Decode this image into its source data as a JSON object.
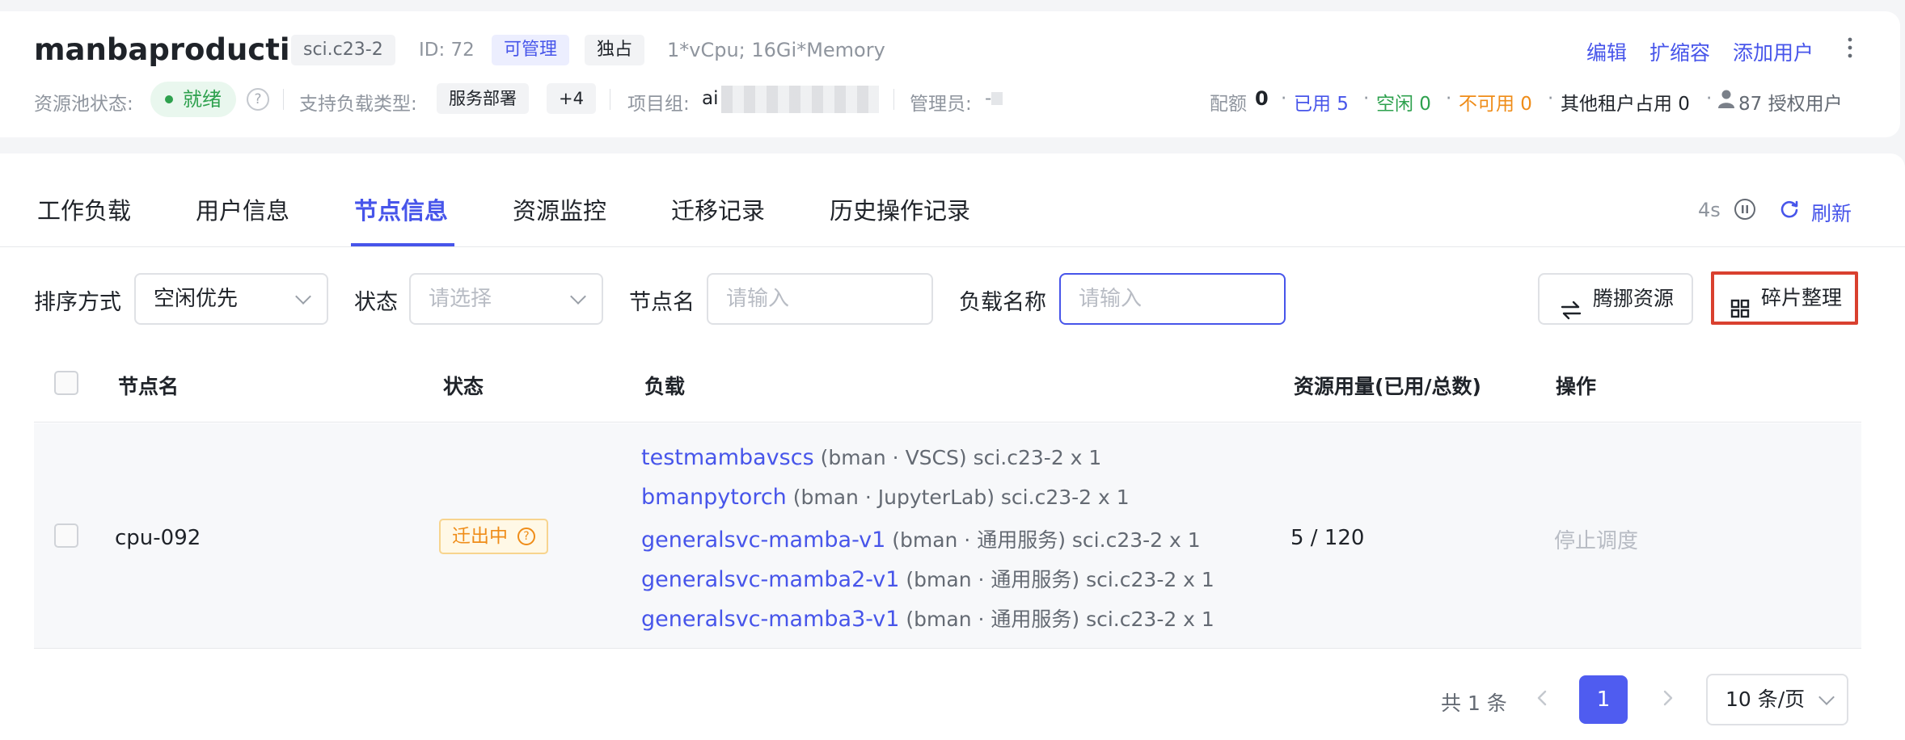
{
  "header": {
    "pool_name": "manbaproduction",
    "spec_tag": "sci.c23-2",
    "id_text": "ID: 72",
    "manage_tag": "可管理",
    "exclusive_tag": "独占",
    "resource_desc": "1*vCpu; 16Gi*Memory",
    "actions": {
      "edit": "编辑",
      "scale": "扩缩容",
      "add_user": "添加用户"
    },
    "status_label": "资源池状态:",
    "status_value": "就绪",
    "workload_label": "支持负载类型:",
    "workload_tag": "服务部署",
    "workload_more": "+4",
    "project_label": "项目组:",
    "project_value": "ai",
    "admin_label": "管理员:",
    "admin_value": "-",
    "quota_label": "配额",
    "quota_value": "0",
    "used": "已用 5",
    "idle": "空闲 0",
    "unavailable": "不可用 0",
    "other_tenant": "其他租户占用 0",
    "authorized_users": "87 授权用户"
  },
  "tabs": [
    {
      "label": "工作负载"
    },
    {
      "label": "用户信息"
    },
    {
      "label": "节点信息",
      "active": true
    },
    {
      "label": "资源监控"
    },
    {
      "label": "迁移记录"
    },
    {
      "label": "历史操作记录"
    }
  ],
  "refresh": {
    "interval": "4s",
    "label": "刷新"
  },
  "filters": {
    "sort_label": "排序方式",
    "sort_value": "空闲优先",
    "status_label": "状态",
    "status_placeholder": "请选择",
    "node_label": "节点名",
    "node_placeholder": "请输入",
    "load_label": "负载名称",
    "load_placeholder": "请输入",
    "transfer_button": "腾挪资源",
    "defrag_button": "碎片整理"
  },
  "table": {
    "columns": [
      "节点名",
      "状态",
      "负载",
      "资源用量(已用/总数)",
      "操作"
    ],
    "rows": [
      {
        "node": "cpu-092",
        "status": "迁出中",
        "loads": [
          {
            "name": "testmambavscs",
            "meta": "(bman · VSCS)",
            "res": "sci.c23-2 x 1"
          },
          {
            "name": "bmanpytorch",
            "meta": "(bman · JupyterLab)",
            "res": "sci.c23-2 x 1"
          },
          {
            "name": "generalsvc-mamba-v1",
            "meta": "(bman · 通用服务)",
            "res": "sci.c23-2 x 1"
          },
          {
            "name": "generalsvc-mamba2-v1",
            "meta": "(bman · 通用服务)",
            "res": "sci.c23-2 x 1"
          },
          {
            "name": "generalsvc-mamba3-v1",
            "meta": "(bman · 通用服务)",
            "res": "sci.c23-2 x 1"
          }
        ],
        "usage": "5 / 120",
        "action": "停止调度"
      }
    ]
  },
  "pagination": {
    "total": "共 1 条",
    "current_page": "1",
    "page_size": "10 条/页"
  }
}
